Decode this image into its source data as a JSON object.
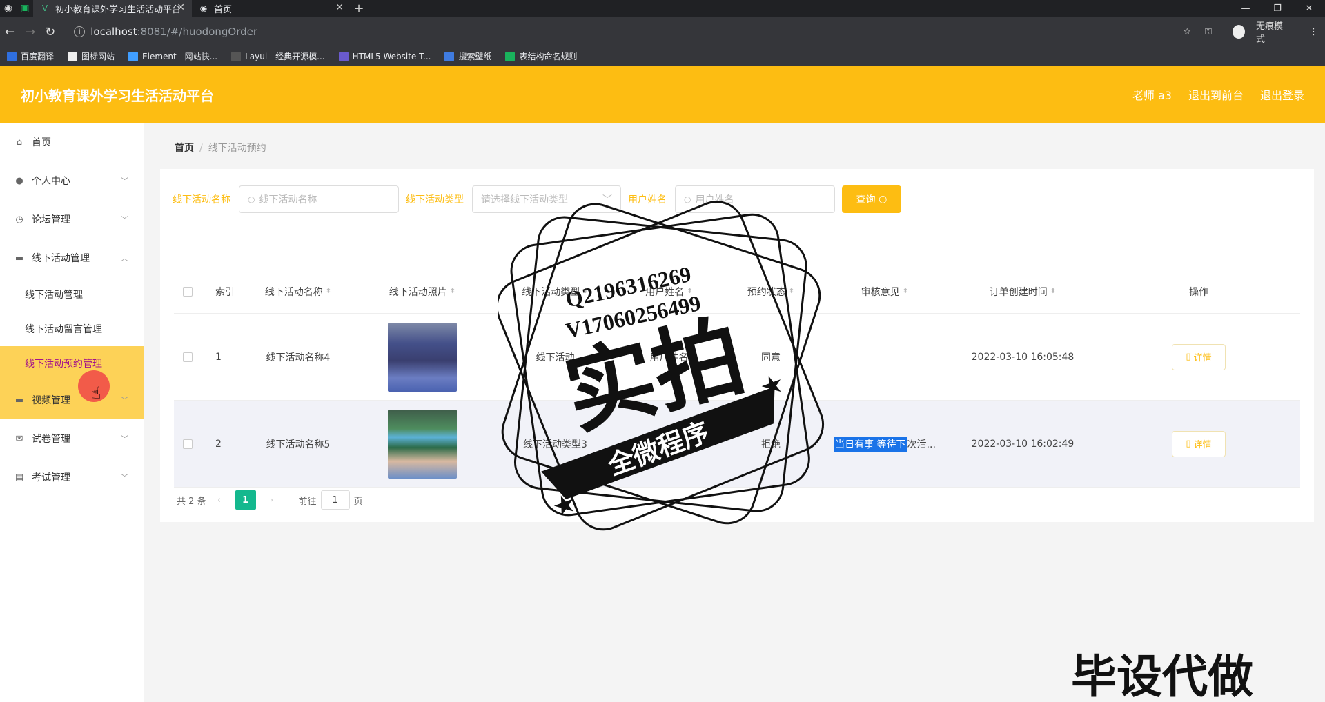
{
  "browser": {
    "tabs": [
      {
        "title": "初小教育课外学习生活活动平台",
        "active": true
      },
      {
        "title": "首页",
        "active": false
      }
    ],
    "url_host": "localhost",
    "url_path": ":8081/#/huodongOrder",
    "incognito_label": "无痕模式",
    "bookmarks": [
      "百度翻译",
      "图标网站",
      "Element - 网站快...",
      "Layui - 经典开源模...",
      "HTML5 Website T...",
      "搜索壁纸",
      "表结构命名规则"
    ]
  },
  "header": {
    "title": "初小教育课外学习生活活动平台",
    "user": "老师 a3",
    "back_front": "退出到前台",
    "logout": "退出登录",
    "accent": "#fdbd12"
  },
  "sidebar": {
    "items": [
      {
        "label": "首页",
        "icon": "home-icon"
      },
      {
        "label": "个人中心",
        "icon": "user-icon"
      },
      {
        "label": "论坛管理",
        "icon": "clock-icon"
      },
      {
        "label": "线下活动管理",
        "icon": "folder-icon"
      },
      {
        "label": "视频管理",
        "icon": "folder-icon"
      },
      {
        "label": "试卷管理",
        "icon": "mail-icon"
      },
      {
        "label": "考试管理",
        "icon": "briefcase-icon"
      }
    ],
    "sub_items": [
      "线下活动管理",
      "线下活动留言管理",
      "线下活动预约管理"
    ]
  },
  "breadcrumb": {
    "home": "首页",
    "current": "线下活动预约"
  },
  "search": {
    "name_label": "线下活动名称",
    "name_placeholder": "线下活动名称",
    "type_label": "线下活动类型",
    "type_placeholder": "请选择线下活动类型",
    "user_label": "用户姓名",
    "user_placeholder": "用户姓名",
    "query_label": "查询"
  },
  "table": {
    "headers": [
      "索引",
      "线下活动名称",
      "线下活动照片",
      "线下活动类型",
      "用户姓名",
      "预约状态",
      "审核意见",
      "订单创建时间",
      "操作"
    ],
    "rows": [
      {
        "index": "1",
        "name": "线下活动名称4",
        "type": "线下活动",
        "user": "用户姓名",
        "status": "同意",
        "review": "",
        "time": "2022-03-10 16:05:48",
        "op": "详情"
      },
      {
        "index": "2",
        "name": "线下活动名称5",
        "type": "线下活动类型3",
        "user": "",
        "status": "拒绝",
        "review_sel": "当日有事 等待下",
        "review_rest": "次活...",
        "time": "2022-03-10 16:02:49",
        "op": "详情"
      }
    ]
  },
  "pager": {
    "total": "共 2 条",
    "page": "1",
    "goto": "前往",
    "goto_value": "1",
    "unit": "页"
  },
  "overlay": {
    "stamp_line1": "Q2196316269",
    "stamp_line2": "V17060256499",
    "stamp_main": "实拍",
    "stamp_banner": "全微程序",
    "corner": "毕设代做"
  }
}
